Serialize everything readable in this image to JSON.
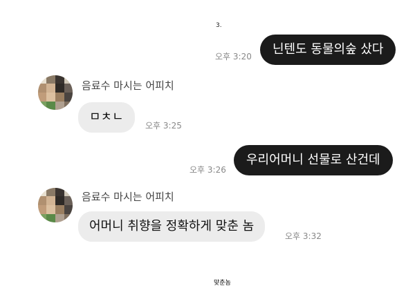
{
  "header": {
    "label": "3."
  },
  "messages": [
    {
      "kind": "out",
      "text": "닌텐도 동물의숲 샀다",
      "time": "오후 3:20"
    },
    {
      "kind": "in",
      "sender": "음료수 마시는 어피치",
      "text": "ㅁㅊㄴ",
      "time": "오후 3:25"
    },
    {
      "kind": "out",
      "text": "우리어머니 선물로 산건데",
      "time": "오후 3:26"
    },
    {
      "kind": "in",
      "sender": "음료수 마시는 어피치",
      "text": "어머니 취향을 정확하게 맞춘 놈",
      "time": "오후 3:32"
    }
  ],
  "footer": {
    "caption": "맞춘놈"
  },
  "colors": {
    "outgoing_bubble": "#1b1b1b",
    "incoming_bubble": "#ececec",
    "timestamp": "#888888"
  },
  "icons": {
    "avatar": "pixelated-profile-avatar"
  }
}
